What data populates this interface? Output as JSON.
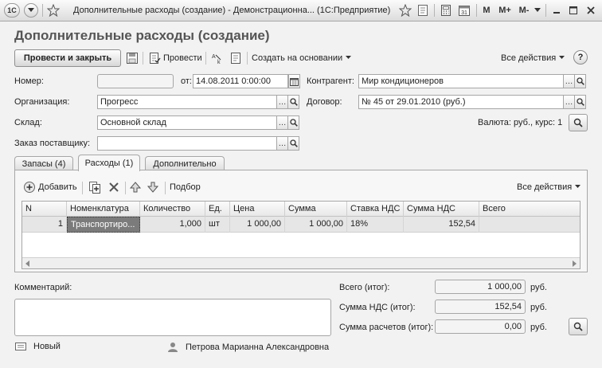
{
  "window": {
    "app_badge": "1С",
    "title": "Дополнительные расходы (создание) - Демонстрационна... (1С:Предприятие)",
    "m_buttons": [
      "M",
      "M+",
      "M-"
    ]
  },
  "form": {
    "title": "Дополнительные расходы (создание)"
  },
  "toolbar": {
    "post_close_label": "Провести и закрыть",
    "post_label": "Провести",
    "create_based_label": "Создать на основании",
    "all_actions_label": "Все действия",
    "help_label": "?"
  },
  "fields": {
    "number": {
      "label": "Номер:",
      "value": ""
    },
    "date": {
      "label": "от:",
      "value": "14.08.2011  0:00:00"
    },
    "counterparty": {
      "label": "Контрагент:",
      "value": "Мир кондиционеров"
    },
    "organization": {
      "label": "Организация:",
      "value": "Прогресс"
    },
    "contract": {
      "label": "Договор:",
      "value": "№ 45 от 29.01.2010 (руб.)"
    },
    "warehouse": {
      "label": "Склад:",
      "value": "Основной склад"
    },
    "currency": {
      "label": "Валюта: руб., курс: 1"
    },
    "supplier_order": {
      "label": "Заказ поставщику:",
      "value": ""
    }
  },
  "tabs": [
    {
      "label": "Запасы (4)"
    },
    {
      "label": "Расходы (1)"
    },
    {
      "label": "Дополнительно"
    }
  ],
  "table_toolbar": {
    "add_label": "Добавить",
    "pick_label": "Подбор",
    "all_actions_label": "Все действия"
  },
  "table": {
    "columns": [
      "N",
      "Номенклатура",
      "Количество",
      "Ед.",
      "Цена",
      "Сумма",
      "Ставка НДС",
      "Сумма НДС",
      "Всего"
    ],
    "rows": [
      {
        "n": "1",
        "item": "Транспортиро...",
        "qty": "1,000",
        "unit": "шт",
        "price": "1 000,00",
        "sum": "1 000,00",
        "vat_rate": "18%",
        "vat_sum": "152,54",
        "total": ""
      }
    ]
  },
  "footer": {
    "comment_label": "Комментарий:",
    "comment_value": "",
    "total_label": "Всего (итог):",
    "total_value": "1 000,00",
    "vat_label": "Сумма НДС (итог):",
    "vat_value": "152,54",
    "settle_label": "Сумма расчетов (итог):",
    "settle_value": "0,00",
    "currency": "руб."
  },
  "status": {
    "state": "Новый",
    "author": "Петрова Марианна Александровна"
  },
  "icons": [
    "app-menu-icon",
    "dropdown-arrow-icon",
    "favorite-star-icon",
    "save-icon",
    "post-icon",
    "spellcheck-icon",
    "document-icon",
    "search-icon",
    "calendar-icon",
    "copy-icon",
    "delete-icon",
    "move-up-icon",
    "move-down-icon",
    "add-icon",
    "user-icon"
  ]
}
